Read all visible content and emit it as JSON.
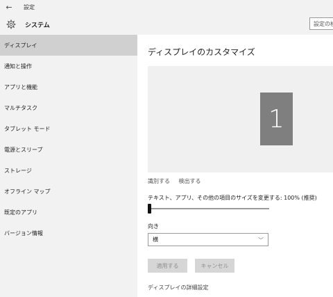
{
  "window": {
    "title": "設定"
  },
  "header": {
    "title": "システム",
    "search_placeholder": "設定の検"
  },
  "sidebar": {
    "items": [
      {
        "label": "ディスプレイ",
        "active": true
      },
      {
        "label": "通知と操作"
      },
      {
        "label": "アプリと機能"
      },
      {
        "label": "マルチタスク"
      },
      {
        "label": "タブレット モード"
      },
      {
        "label": "電源とスリープ"
      },
      {
        "label": "ストレージ"
      },
      {
        "label": "オフライン マップ"
      },
      {
        "label": "既定のアプリ"
      },
      {
        "label": "バージョン情報"
      }
    ]
  },
  "main": {
    "page_title": "ディスプレイのカスタマイズ",
    "monitor_number": "1",
    "identify_link": "識別する",
    "detect_link": "検出する",
    "scale_label": "テキスト、アプリ、その他の項目のサイズを変更する: 100% (推奨)",
    "scale_value_percent": 0,
    "orientation_label": "向き",
    "orientation_value": "横",
    "apply_button": "適用する",
    "cancel_button": "キャンセル",
    "advanced_link": "ディスプレイの詳細設定"
  }
}
